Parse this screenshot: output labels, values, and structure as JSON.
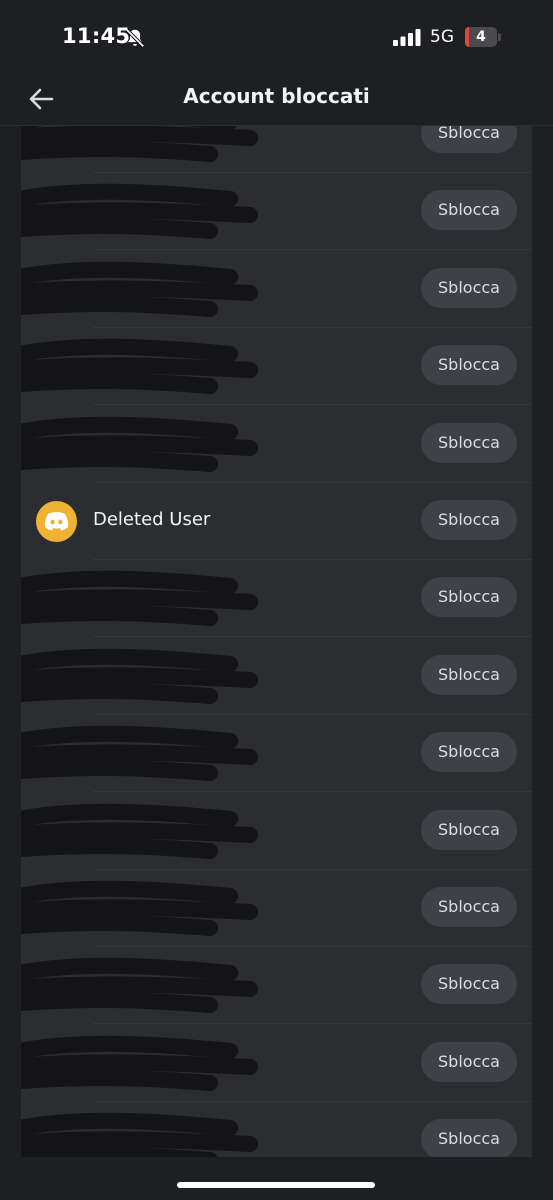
{
  "status_bar": {
    "time": "11:45",
    "network": "5G",
    "battery": "4"
  },
  "header": {
    "title": "Account bloccati",
    "back_icon": "arrow-left-icon"
  },
  "blocked_list": {
    "unblock_label": "Sblocca",
    "rows": [
      {
        "name": "",
        "redacted": true
      },
      {
        "name": "",
        "redacted": true
      },
      {
        "name": "",
        "redacted": true
      },
      {
        "name": "",
        "redacted": true
      },
      {
        "name": "",
        "redacted": true
      },
      {
        "name": "Deleted User",
        "redacted": false,
        "avatar_color": "#f0b232",
        "avatar_icon": "discord-logo-icon"
      },
      {
        "name": "",
        "redacted": true
      },
      {
        "name": "",
        "redacted": true
      },
      {
        "name": "",
        "redacted": true
      },
      {
        "name": "",
        "redacted": true
      },
      {
        "name": "",
        "redacted": true
      },
      {
        "name": "",
        "redacted": true
      },
      {
        "name": "",
        "redacted": true
      },
      {
        "name": "",
        "redacted": true
      }
    ]
  },
  "colors": {
    "background": "#1e1f22",
    "list_background": "#2b2d31",
    "button_background": "#3f4147",
    "avatar_accent": "#f0b232"
  }
}
